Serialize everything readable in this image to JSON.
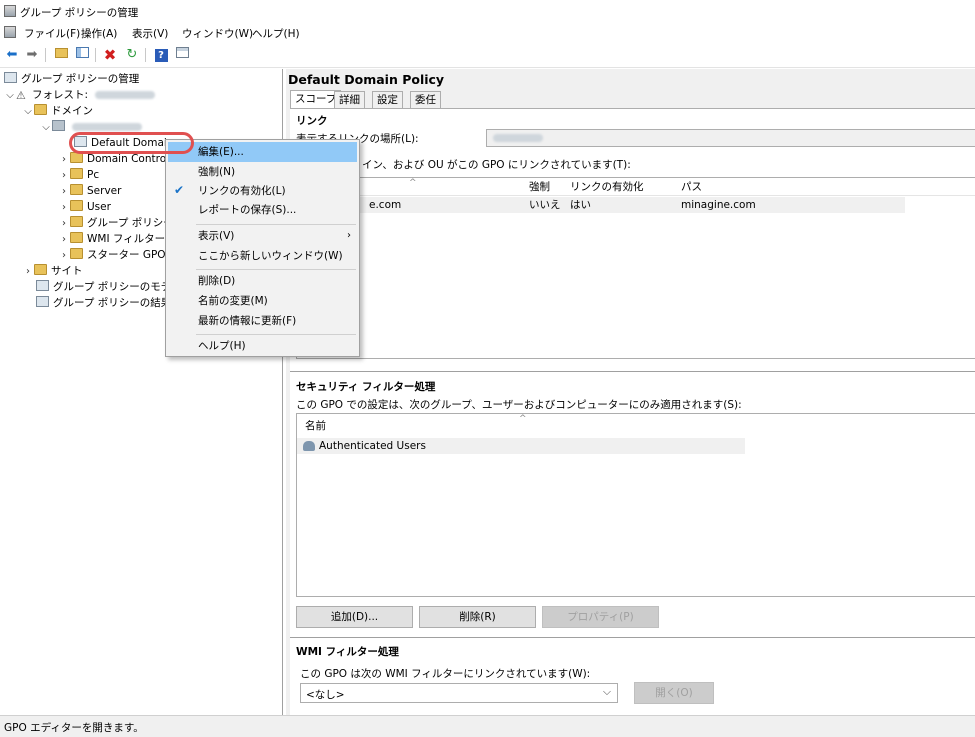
{
  "window": {
    "title": "グループ ポリシーの管理"
  },
  "menubar": {
    "items": [
      "ファイル(F)",
      "操作(A)",
      "表示(V)",
      "ウィンドウ(W)",
      "ヘルプ(H)"
    ]
  },
  "toolbar": {
    "icons": [
      "back-arrow-icon",
      "forward-arrow-icon",
      "folder-up-icon",
      "console-tree-icon",
      "delete-icon",
      "refresh-icon",
      "help-icon",
      "show-hide-icon"
    ]
  },
  "tree": {
    "root": "グループ ポリシーの管理",
    "forest": "フォレスト:",
    "domains": "ドメイン",
    "default_domain": "Default Domain",
    "items": [
      "Domain Contro",
      "Pc",
      "Server",
      "User",
      "グループ ポリシー",
      "WMI フィルター",
      "スターター GPO"
    ],
    "sites": "サイト",
    "modeling": "グループ ポリシーのモデル",
    "results": "グループ ポリシーの結果"
  },
  "details": {
    "title": "Default Domain Policy",
    "tabs": [
      "スコープ",
      "詳細",
      "設定",
      "委任"
    ],
    "links": {
      "title": "リンク",
      "location_label": "表示するリンクの場所(L):",
      "description": "イン、および OU がこの GPO にリンクされています(T):",
      "columns": [
        "強制",
        "リンクの有効化",
        "パス"
      ],
      "rows": [
        {
          "location": "e.com",
          "enforced": "いいえ",
          "enabled": "はい",
          "path": "minagine.com"
        }
      ]
    },
    "security": {
      "title": "セキュリティ フィルター処理",
      "description": "この GPO での設定は、次のグループ、ユーザーおよびコンピューターにのみ適用されます(S):",
      "column": "名前",
      "rows": [
        "Authenticated Users"
      ],
      "buttons": {
        "add": "追加(D)...",
        "remove": "削除(R)",
        "properties": "プロパティ(P)"
      }
    },
    "wmi": {
      "title": "WMI フィルター処理",
      "description": "この GPO は次の WMI フィルターにリンクされています(W):",
      "selected": "<なし>",
      "open_button": "開く(O)"
    }
  },
  "context_menu": {
    "edit": "編集(E)...",
    "enforce": "強制(N)",
    "link_enabled": "リンクの有効化(L)",
    "save_report": "レポートの保存(S)...",
    "view": "表示(V)",
    "new_window": "ここから新しいウィンドウ(W)",
    "delete": "削除(D)",
    "rename": "名前の変更(M)",
    "refresh": "最新の情報に更新(F)",
    "help": "ヘルプ(H)"
  },
  "status": {
    "text": "GPO エディターを開きます。"
  },
  "colors": {
    "highlight": "#91c9f7",
    "annotation": "#e05050",
    "pane_bg": "#f0f0f0"
  }
}
